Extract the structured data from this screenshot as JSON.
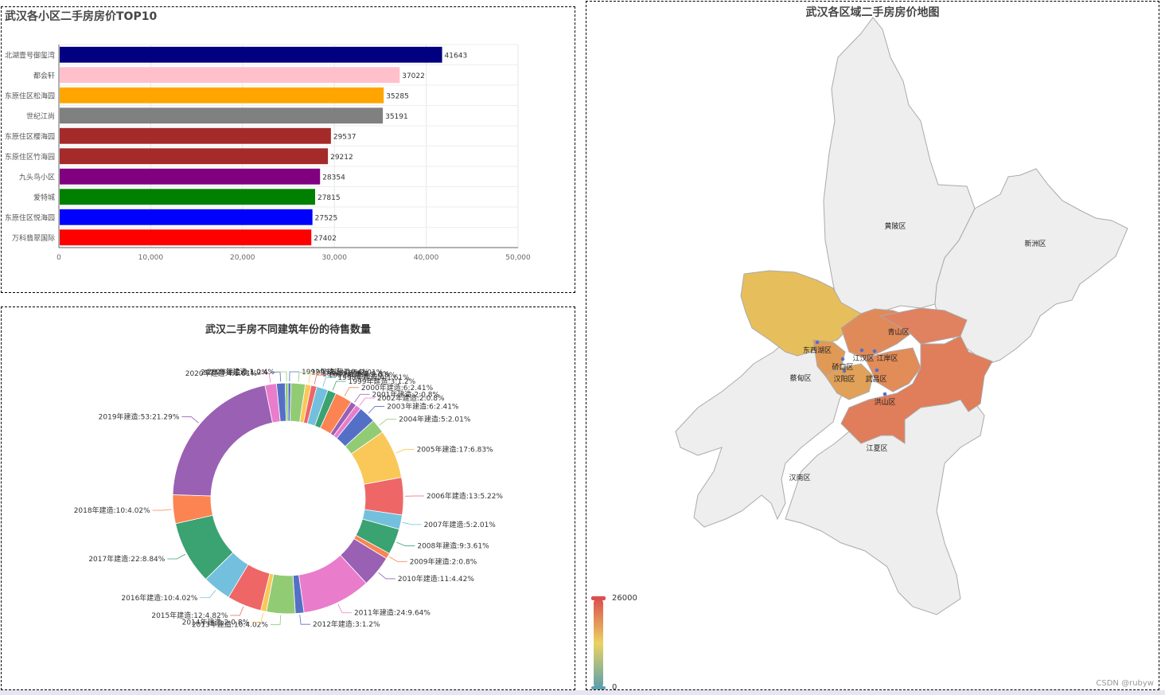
{
  "chart_data": [
    {
      "type": "bar",
      "orientation": "horizontal",
      "title": "武汉各小区二手房房价TOP10",
      "categories": [
        "北湖壹号御玺湾",
        "都会轩",
        "东原住区松海园",
        "世纪江尚",
        "东原住区樱海园",
        "东原住区竹海园",
        "九头鸟小区",
        "爱特城",
        "东原住区悦海园",
        "万科翡翠国际"
      ],
      "values": [
        41643,
        37022,
        35285,
        35191,
        29537,
        29212,
        28354,
        27815,
        27525,
        27402
      ],
      "colors": [
        "#000080",
        "#ffc0cb",
        "#ffa500",
        "#808080",
        "#a52a2a",
        "#a52a2a",
        "#800080",
        "#008000",
        "#0000ff",
        "#ff0000"
      ],
      "xlim": [
        0,
        50000
      ],
      "xticks": [
        0,
        10000,
        20000,
        30000,
        40000,
        50000
      ],
      "xtick_labels": [
        "0",
        "10,000",
        "20,000",
        "30,000",
        "40,000",
        "50,000"
      ],
      "grid": true
    },
    {
      "type": "pie",
      "style": "donut",
      "title": "武汉二手房不同建筑年份的待售数量",
      "slices": [
        {
          "label": "1992年建造:1:0.4%",
          "value": 1
        },
        {
          "label": "1995年建造:5:2.01%",
          "value": 5
        },
        {
          "label": "1996年建造:2:0.8%",
          "value": 2
        },
        {
          "label": "1997年建造:2:0.8%",
          "value": 2
        },
        {
          "label": "1998年建造:4:1.61%",
          "value": 4
        },
        {
          "label": "1999年建造:3:1.2%",
          "value": 3
        },
        {
          "label": "2000年建造:6:2.41%",
          "value": 6
        },
        {
          "label": "2001年建造:2:0.8%",
          "value": 2
        },
        {
          "label": "2002年建造:2:0.8%",
          "value": 2
        },
        {
          "label": "2003年建造:6:2.41%",
          "value": 6
        },
        {
          "label": "2004年建造:5:2.01%",
          "value": 5
        },
        {
          "label": "2005年建造:17:6.83%",
          "value": 17
        },
        {
          "label": "2006年建造:13:5.22%",
          "value": 13
        },
        {
          "label": "2007年建造:5:2.01%",
          "value": 5
        },
        {
          "label": "2008年建造:9:3.61%",
          "value": 9
        },
        {
          "label": "2009年建造:2:0.8%",
          "value": 2
        },
        {
          "label": "2010年建造:11:4.42%",
          "value": 11
        },
        {
          "label": "2011年建造:24:9.64%",
          "value": 24
        },
        {
          "label": "2012年建造:3:1.2%",
          "value": 3
        },
        {
          "label": "2013年建造:10:4.02%",
          "value": 10
        },
        {
          "label": "2014年建造:2:0.8%",
          "value": 2
        },
        {
          "label": "2015年建造:12:4.82%",
          "value": 12
        },
        {
          "label": "2016年建造:10:4.02%",
          "value": 10
        },
        {
          "label": "2017年建造:22:8.84%",
          "value": 22
        },
        {
          "label": "2018年建造:10:4.02%",
          "value": 10
        },
        {
          "label": "2019年建造:53:21.29%",
          "value": 53
        },
        {
          "label": "2020年建造:4:1.61%",
          "value": 4
        },
        {
          "label": "2021年建造:3:1.2%",
          "value": 3
        },
        {
          "label": "2023年建造:1:0.4%",
          "value": 1
        }
      ],
      "palette": [
        "#5470c6",
        "#91cc75",
        "#fac858",
        "#ee6666",
        "#73c0de",
        "#3ba272",
        "#fc8452",
        "#9a60b4",
        "#ea7ccc"
      ]
    },
    {
      "type": "map",
      "title": "武汉各区域二手房房价地图",
      "regions": [
        {
          "name": "黄陂区",
          "value": null
        },
        {
          "name": "新洲区",
          "value": null
        },
        {
          "name": "东西湖区",
          "value": null
        },
        {
          "name": "青山区",
          "value": null
        },
        {
          "name": "江岸区",
          "value": null
        },
        {
          "name": "江汉区",
          "value": null
        },
        {
          "name": "硚口区",
          "value": null
        },
        {
          "name": "汉阳区",
          "value": null
        },
        {
          "name": "武昌区",
          "value": null
        },
        {
          "name": "洪山区",
          "value": null
        },
        {
          "name": "蔡甸区",
          "value": null
        },
        {
          "name": "江夏区",
          "value": null
        },
        {
          "name": "汉南区",
          "value": null
        }
      ],
      "visual_map": {
        "min": 0,
        "max": 26000,
        "min_label": "0",
        "max_label": "26000",
        "colors": [
          "#5ba0ac",
          "#ead361",
          "#dd4f4f"
        ]
      }
    }
  ],
  "credit": "CSDN @rubyw"
}
